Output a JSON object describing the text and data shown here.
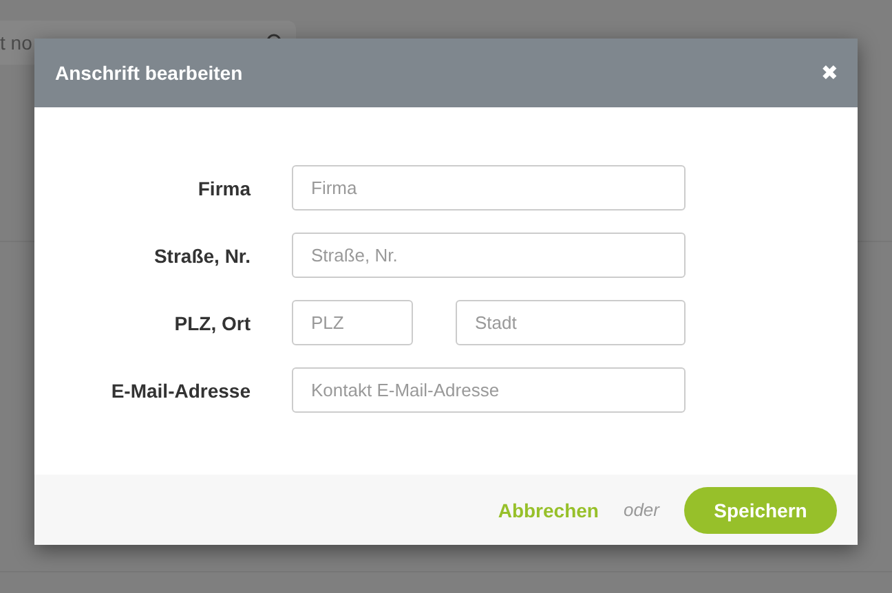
{
  "background": {
    "search_field": {
      "value": "t no"
    }
  },
  "dialog": {
    "title": "Anschrift bearbeiten",
    "close": "✖",
    "rows": [
      {
        "label": "Firma",
        "fields": [
          {
            "placeholder": "Firma",
            "kind": "wide"
          }
        ]
      },
      {
        "label": "Straße, Nr.",
        "fields": [
          {
            "placeholder": "Straße, Nr.",
            "kind": "wide"
          }
        ]
      },
      {
        "label": "PLZ, Ort",
        "fields": [
          {
            "placeholder": "PLZ",
            "kind": "short"
          },
          {
            "placeholder": "Stadt",
            "kind": "rest"
          }
        ]
      },
      {
        "label": "E-Mail-Adresse",
        "fields": [
          {
            "placeholder": "Kontakt E-Mail-Adresse",
            "kind": "wide"
          }
        ]
      }
    ],
    "footer": {
      "cancel": "Abbrechen",
      "separator": "oder",
      "save": "Speichern"
    }
  }
}
